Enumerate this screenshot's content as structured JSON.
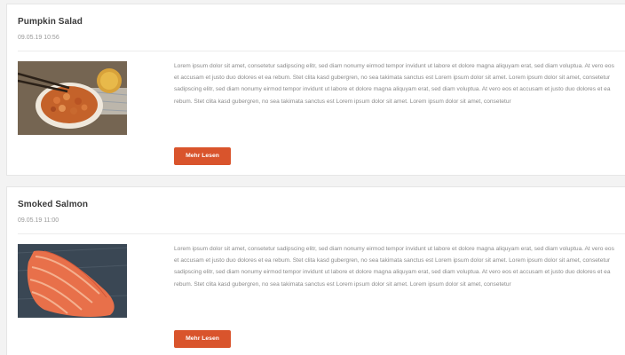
{
  "posts": [
    {
      "title": "Pumpkin Salad",
      "date": "09.05.19 10:56",
      "image_icon": "pumpkin-salad-photo",
      "text": "Lorem ipsum dolor sit amet, consetetur sadipscing elitr, sed diam nonumy eirmod tempor invidunt ut labore et dolore magna aliquyam erat, sed diam voluptua. At vero eos et accusam et justo duo dolores et ea rebum. Stet clita kasd gubergren, no sea takimata sanctus est Lorem ipsum dolor sit amet. Lorem ipsum dolor sit amet, consetetur sadipscing elitr, sed diam nonumy eirmod tempor invidunt ut labore et dolore magna aliquyam erat, sed diam voluptua. At vero eos et accusam et justo duo dolores et ea rebum. Stet clita kasd gubergren, no sea takimata sanctus est Lorem ipsum dolor sit amet. Lorem ipsum dolor sit amet, consetetur",
      "button_label": "Mehr Lesen"
    },
    {
      "title": "Smoked Salmon",
      "date": "09.05.19 11:00",
      "image_icon": "smoked-salmon-photo",
      "text": "Lorem ipsum dolor sit amet, consetetur sadipscing elitr, sed diam nonumy eirmod tempor invidunt ut labore et dolore magna aliquyam erat, sed diam voluptua. At vero eos et accusam et justo duo dolores et ea rebum. Stet clita kasd gubergren, no sea takimata sanctus est Lorem ipsum dolor sit amet. Lorem ipsum dolor sit amet, consetetur sadipscing elitr, sed diam nonumy eirmod tempor invidunt ut labore et dolore magna aliquyam erat, sed diam voluptua. At vero eos et accusam et justo duo dolores et ea rebum. Stet clita kasd gubergren, no sea takimata sanctus est Lorem ipsum dolor sit amet. Lorem ipsum dolor sit amet, consetetur",
      "button_label": "Mehr Lesen"
    }
  ],
  "colors": {
    "button": "#d9542c",
    "title": "#3a3a3a",
    "meta": "#9a9a9a",
    "body": "#8a8a8a"
  }
}
